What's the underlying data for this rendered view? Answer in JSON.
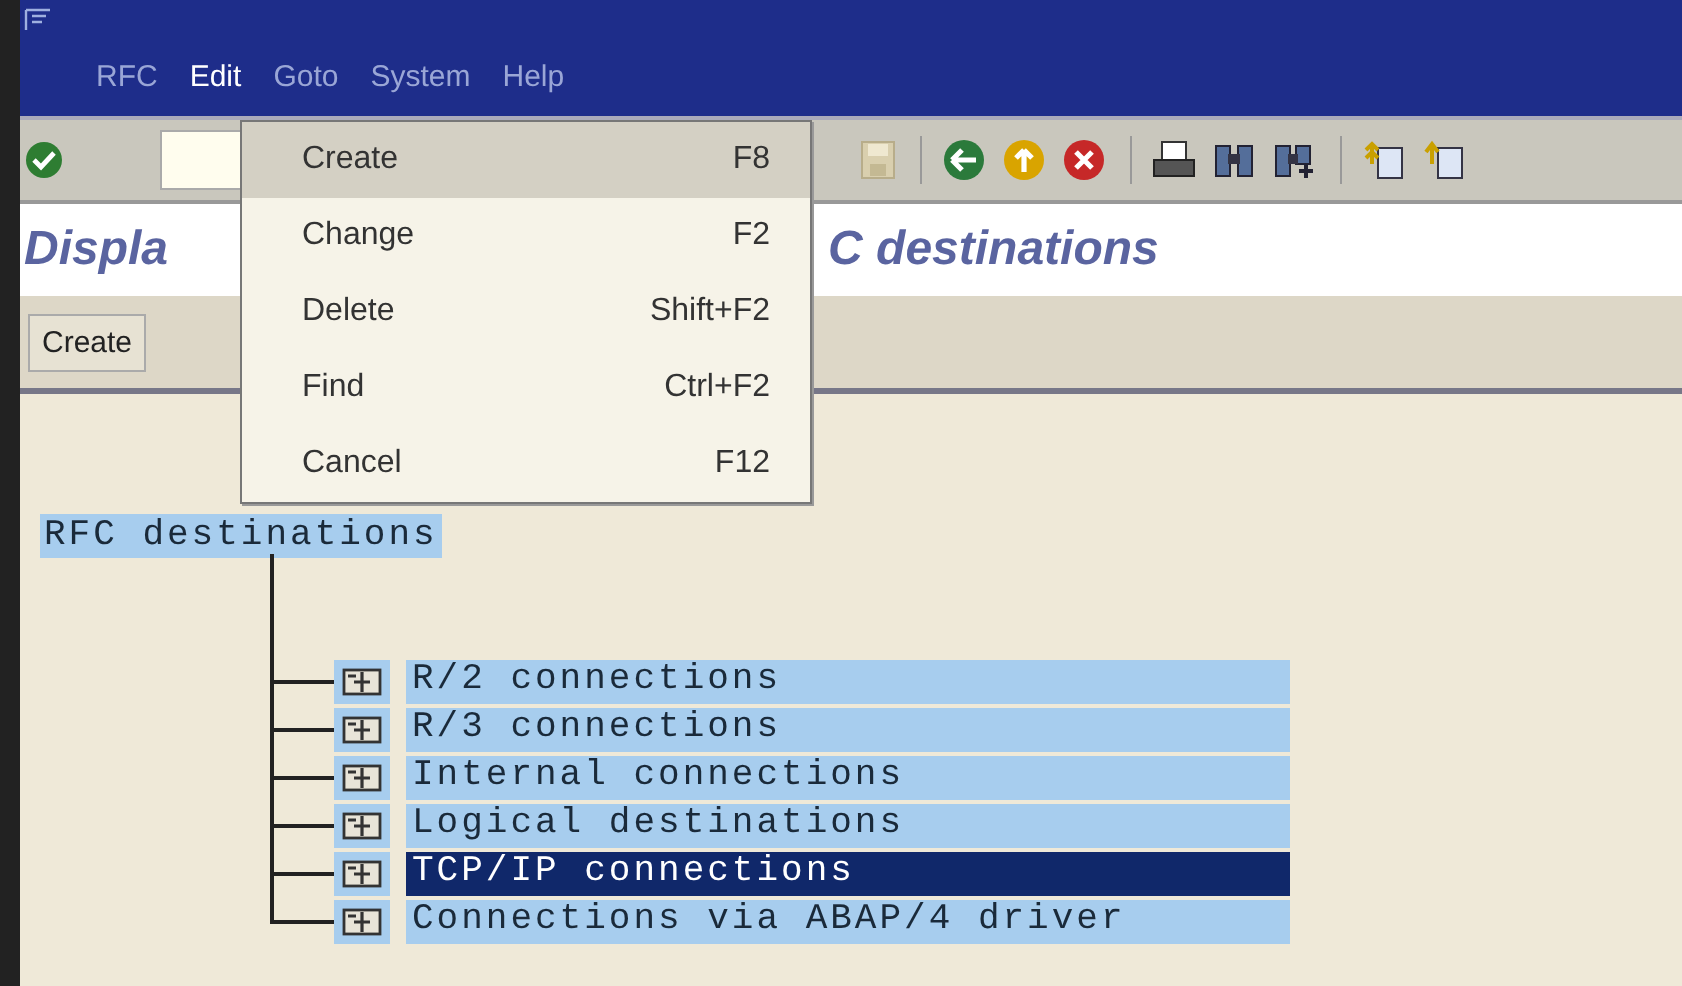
{
  "menu_bar": [
    {
      "label": "RFC",
      "selected": false
    },
    {
      "label": "Edit",
      "selected": true
    },
    {
      "label": "Goto",
      "selected": false
    },
    {
      "label": "System",
      "selected": false
    },
    {
      "label": "Help",
      "selected": false
    }
  ],
  "edit_menu": [
    {
      "label": "Create",
      "shortcut": "F8",
      "selected": true
    },
    {
      "label": "Change",
      "shortcut": "F2",
      "selected": false
    },
    {
      "label": "Delete",
      "shortcut": "Shift+F2",
      "selected": false
    },
    {
      "label": "Find",
      "shortcut": "Ctrl+F2",
      "selected": false
    },
    {
      "label": "Cancel",
      "shortcut": "F12",
      "selected": false
    }
  ],
  "title_visible_start": "Displa",
  "title_visible_end": "C destinations",
  "app_toolbar": {
    "button": "Create"
  },
  "tree": {
    "label": "RFC destinations",
    "selected": false,
    "children": [
      {
        "label": "R/2 connections",
        "selected": false
      },
      {
        "label": "R/3 connections",
        "selected": false
      },
      {
        "label": "Internal connections",
        "selected": false
      },
      {
        "label": "Logical destinations",
        "selected": false
      },
      {
        "label": "TCP/IP connections",
        "selected": true
      },
      {
        "label": "Connections via ABAP/4 driver",
        "selected": false
      }
    ]
  }
}
